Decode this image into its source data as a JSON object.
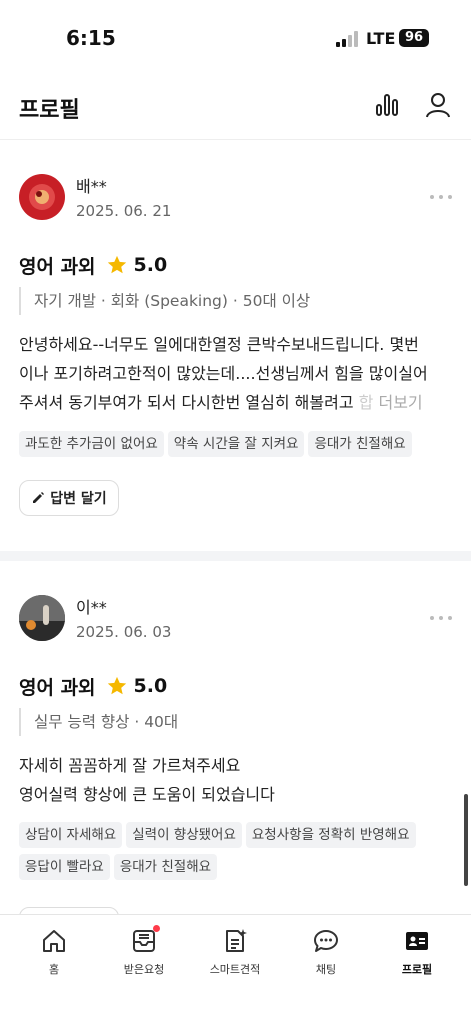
{
  "status_bar": {
    "time": "6:15",
    "network": "LTE",
    "battery": "96"
  },
  "header": {
    "title": "프로필"
  },
  "reviews": [
    {
      "name": "배**",
      "date": "2025. 06. 21",
      "service": "영어 과외",
      "rating": "5.0",
      "meta": "자기 개발 · 회화 (Speaking) · 50대 이상",
      "text_lines": [
        "안녕하세요--너무도 일에대한열정 큰박수보내드립니다. 몇번",
        "이나 포기하려고한적이 많았는데....선생님께서 힘을 많이실어",
        "주셔셔 동기부여가 되서 다시한번 열심히 해볼려고 "
      ],
      "text_fade": "합",
      "more_label": "더보기",
      "tags": [
        "과도한 추가금이 없어요",
        "약속 시간을 잘 지켜요",
        "응대가 친절해요"
      ],
      "reply_label": "답변 달기"
    },
    {
      "name": "이**",
      "date": "2025. 06. 03",
      "service": "영어 과외",
      "rating": "5.0",
      "meta": "실무 능력 향상 · 40대",
      "text_lines": [
        "자세히 꼼꼼하게 잘 가르쳐주세요",
        "영어실력 향상에 큰 도움이 되었습니다"
      ],
      "tags": [
        "상담이 자세해요",
        "실력이 향상됐어요",
        "요청사항을 정확히 반영해요",
        "응답이 빨라요",
        "응대가 친절해요"
      ]
    }
  ],
  "tabs": [
    {
      "label": "홈",
      "icon": "home-icon"
    },
    {
      "label": "받은요청",
      "icon": "inbox-icon"
    },
    {
      "label": "스마트견적",
      "icon": "smart-quote-icon"
    },
    {
      "label": "채팅",
      "icon": "chat-icon"
    },
    {
      "label": "프로필",
      "icon": "profile-card-icon"
    }
  ],
  "colors": {
    "accent": "#ff3b4a",
    "star": "#f5b800",
    "tag_bg": "#f1f2f4"
  }
}
